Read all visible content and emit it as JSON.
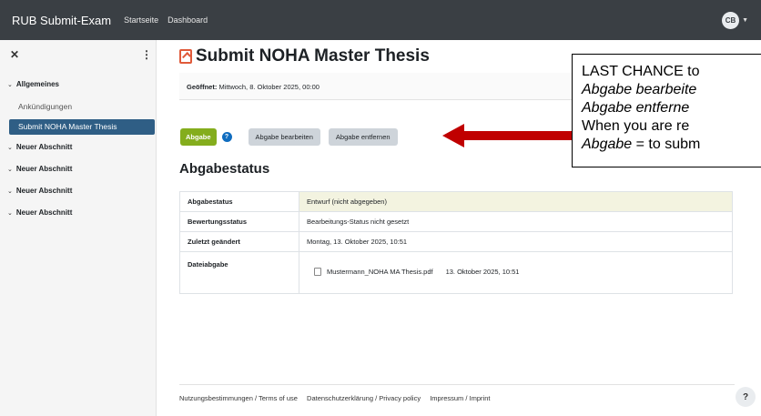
{
  "navbar": {
    "brand": "RUB Submit-Exam",
    "links": [
      "Startseite",
      "Dashboard"
    ],
    "avatar_initials": "CB"
  },
  "sidebar": {
    "sections": [
      {
        "label": "Allgemeines",
        "items": [
          "Ankündigungen",
          "Submit NOHA Master Thesis"
        ]
      },
      {
        "label": "Neuer Abschnitt"
      },
      {
        "label": "Neuer Abschnitt"
      },
      {
        "label": "Neuer Abschnitt"
      },
      {
        "label": "Neuer Abschnitt"
      }
    ],
    "active_item": "Submit NOHA Master Thesis"
  },
  "main": {
    "title": "Submit NOHA Master Thesis",
    "opened_label": "Geöffnet:",
    "opened_value": "Mittwoch, 8. Oktober 2025, 00:00",
    "buttons": {
      "submit": "Abgabe",
      "edit": "Abgabe bearbeiten",
      "remove": "Abgabe entfernen"
    },
    "status_heading": "Abgabestatus",
    "status_rows": [
      {
        "label": "Abgabestatus",
        "value": "Entwurf (nicht abgegeben)"
      },
      {
        "label": "Bewertungsstatus",
        "value": "Bearbeitungs-Status nicht gesetzt"
      },
      {
        "label": "Zuletzt geändert",
        "value": "Montag, 13. Oktober 2025, 10:51"
      },
      {
        "label": "Dateiabgabe",
        "file_name": "Mustermann_NOHA MA Thesis.pdf",
        "file_date": "13. Oktober 2025, 10:51"
      }
    ]
  },
  "footer": {
    "links": [
      "Nutzungsbestimmungen / Terms of use",
      "Datenschutzerklärung / Privacy policy",
      "Impressum / Imprint"
    ],
    "help": "?"
  },
  "callout": {
    "line1": "LAST CHANCE to",
    "line2": "Abgabe bearbeite",
    "line3": "Abgabe entferne",
    "line4": "When you are re",
    "line5_italic": "Abgabe",
    "line5_rest": " = to subm"
  },
  "colors": {
    "navbar": "#3a3f44",
    "active": "#2f5e85",
    "submit_button": "#84ad1d",
    "arrow": "#c00000"
  }
}
